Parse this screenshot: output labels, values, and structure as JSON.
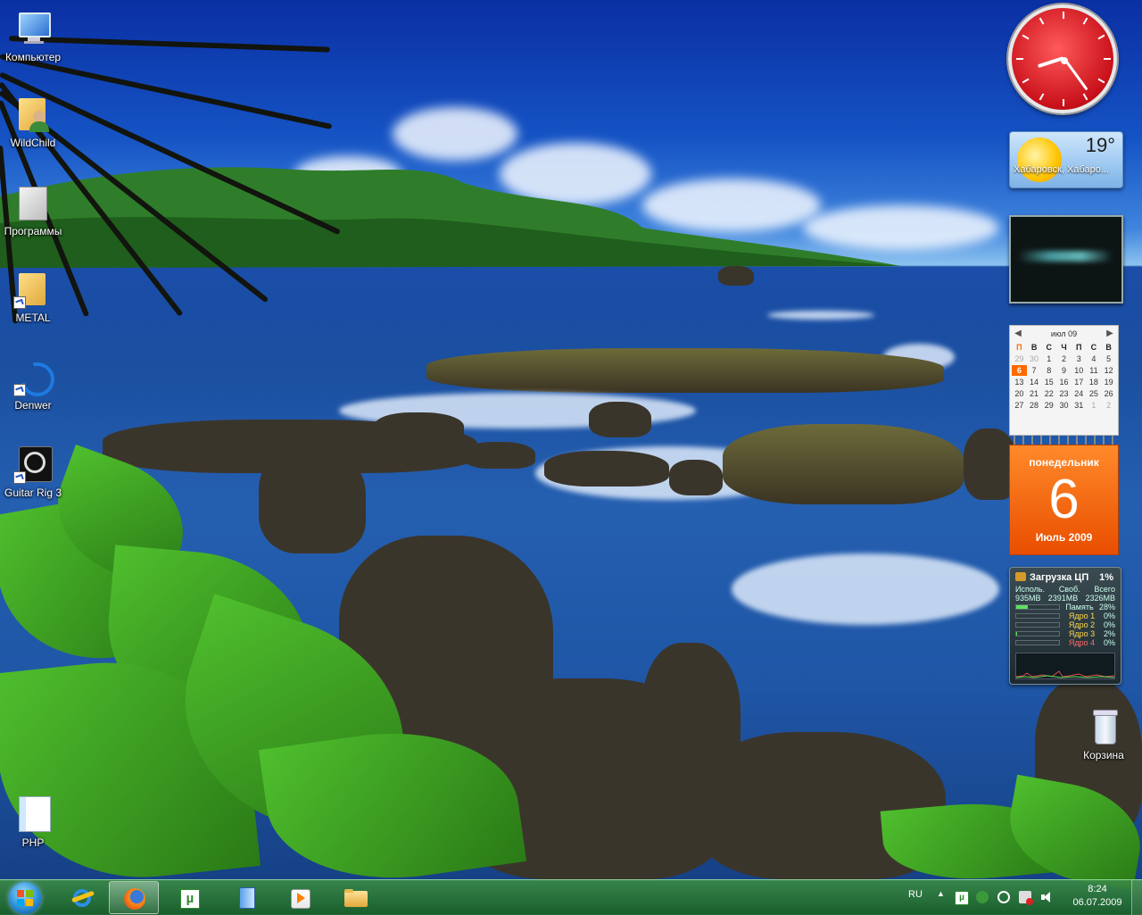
{
  "desktop": {
    "icons": [
      {
        "label": "Компьютер",
        "icon": "computer-icon"
      },
      {
        "label": "WildChild",
        "icon": "user-folder-icon"
      },
      {
        "label": "Программы",
        "icon": "programs-icon"
      },
      {
        "label": "METAL",
        "icon": "folder-shortcut-icon"
      },
      {
        "label": "Denwer",
        "icon": "denwer-icon"
      },
      {
        "label": "Guitar Rig 3",
        "icon": "guitar-rig-icon"
      },
      {
        "label": "PHP",
        "icon": "php-icon"
      },
      {
        "label": "Корзина",
        "icon": "recycle-bin-icon"
      }
    ]
  },
  "gadgets": {
    "clock": {
      "hour": 8,
      "minute": 24,
      "color": "#d0141c"
    },
    "weather": {
      "temperature": "19°",
      "city": "Хабаровск, Хабаро..."
    },
    "calendar": {
      "month_header": "июл 09",
      "weekdays": [
        "П",
        "В",
        "С",
        "Ч",
        "П",
        "С",
        "В"
      ],
      "weeks": [
        [
          "29",
          "30",
          "1",
          "2",
          "3",
          "4",
          "5"
        ],
        [
          "6",
          "7",
          "8",
          "9",
          "10",
          "11",
          "12"
        ],
        [
          "13",
          "14",
          "15",
          "16",
          "17",
          "18",
          "19"
        ],
        [
          "20",
          "21",
          "22",
          "23",
          "24",
          "25",
          "26"
        ],
        [
          "27",
          "28",
          "29",
          "30",
          "31",
          "1",
          "2"
        ]
      ],
      "today": "6",
      "weekday_name": "понедельник",
      "day_number": "6",
      "month_year": "Июль 2009",
      "accent": "#ff6a00"
    },
    "cpu": {
      "title": "Загрузка ЦП",
      "percent": "1%",
      "memory_headers": [
        "Исполь.",
        "Своб.",
        "Всего"
      ],
      "memory_values": [
        "935MB",
        "2391MB",
        "2326MB"
      ],
      "rows": [
        {
          "label": "Память",
          "value": "28%",
          "fill": 0.28
        },
        {
          "label": "Ядро 1",
          "value": "0%",
          "fill": 0
        },
        {
          "label": "Ядро 2",
          "value": "0%",
          "fill": 0
        },
        {
          "label": "Ядро 3",
          "value": "2%",
          "fill": 0.02
        },
        {
          "label": "Ядро 4",
          "value": "0%",
          "fill": 0
        }
      ]
    }
  },
  "taskbar": {
    "start_icon": "windows-flag-icon",
    "buttons": [
      {
        "name": "ie-taskbar-button",
        "icon": "internet-explorer-icon"
      },
      {
        "name": "firefox-taskbar-button",
        "icon": "firefox-icon",
        "active": true
      },
      {
        "name": "utorrent-taskbar-button",
        "icon": "utorrent-icon"
      },
      {
        "name": "document-taskbar-button",
        "icon": "document-icon"
      },
      {
        "name": "media-player-taskbar-button",
        "icon": "media-player-icon"
      },
      {
        "name": "explorer-taskbar-button",
        "icon": "folder-icon"
      }
    ],
    "tray": {
      "language": "RU",
      "time": "8:24",
      "date": "06.07.2009"
    }
  }
}
